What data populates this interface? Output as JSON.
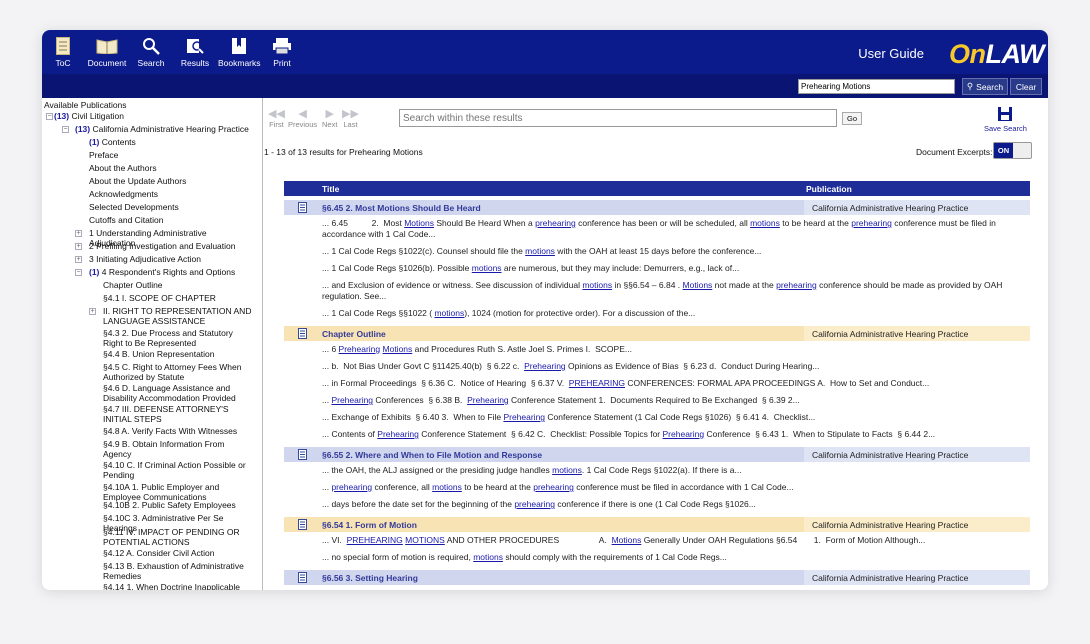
{
  "toolbar": {
    "toc": "ToC",
    "document": "Document",
    "search": "Search",
    "results": "Results",
    "bookmarks": "Bookmarks",
    "print": "Print",
    "user_guide": "User Guide",
    "logo_on": "On",
    "logo_law": "LAW"
  },
  "searchbar": {
    "value": "Prehearing Motions",
    "search_label": "Search",
    "clear_label": "Clear"
  },
  "sidebar": {
    "heading": "Available Publications",
    "items": [
      {
        "toggle": "−",
        "count": "(13)",
        "label": "Civil Litigation"
      },
      {
        "toggle": "−",
        "count": "(13)",
        "label": "California Administrative Hearing Practice"
      },
      {
        "toggle": "",
        "count": "(1)",
        "label": "Contents"
      },
      {
        "toggle": "",
        "count": "",
        "label": "Preface"
      },
      {
        "toggle": "",
        "count": "",
        "label": "About the Authors"
      },
      {
        "toggle": "",
        "count": "",
        "label": "About the Update Authors"
      },
      {
        "toggle": "",
        "count": "",
        "label": "Acknowledgments"
      },
      {
        "toggle": "",
        "count": "",
        "label": "Selected Developments"
      },
      {
        "toggle": "",
        "count": "",
        "label": "Cutoffs and Citation"
      },
      {
        "toggle": "+",
        "count": "",
        "label": "1 Understanding Administrative Adjudication"
      },
      {
        "toggle": "+",
        "count": "",
        "label": "2 Prefiling Investigation and Evaluation"
      },
      {
        "toggle": "+",
        "count": "",
        "label": "3 Initiating Adjudicative Action"
      },
      {
        "toggle": "−",
        "count": "(1)",
        "label": "4 Respondent's Rights and Options"
      },
      {
        "toggle": "",
        "count": "",
        "label": "Chapter Outline"
      },
      {
        "toggle": "",
        "count": "",
        "label": "§4.1 I. SCOPE OF CHAPTER"
      },
      {
        "toggle": "+",
        "count": "",
        "label": "II. RIGHT TO REPRESENTATION AND LANGUAGE ASSISTANCE"
      },
      {
        "toggle": "",
        "count": "",
        "label": "§4.3 2. Due Process and Statutory Right to Be Represented"
      },
      {
        "toggle": "",
        "count": "",
        "label": "§4.4 B. Union Representation"
      },
      {
        "toggle": "",
        "count": "",
        "label": "§4.5 C. Right to Attorney Fees When Authorized by Statute"
      },
      {
        "toggle": "",
        "count": "",
        "label": "§4.6 D. Language Assistance and Disability Accommodation Provided"
      },
      {
        "toggle": "",
        "count": "",
        "label": "§4.7 III. DEFENSE ATTORNEY'S INITIAL STEPS"
      },
      {
        "toggle": "",
        "count": "",
        "label": "§4.8 A. Verify Facts With Witnesses"
      },
      {
        "toggle": "",
        "count": "",
        "label": "§4.9 B. Obtain Information From Agency"
      },
      {
        "toggle": "",
        "count": "",
        "label": "§4.10 C. If Criminal Action Possible or Pending"
      },
      {
        "toggle": "",
        "count": "",
        "label": "§4.10A 1. Public Employer and Employee Communications"
      },
      {
        "toggle": "",
        "count": "",
        "label": "§4.10B 2. Public Safety Employees"
      },
      {
        "toggle": "",
        "count": "",
        "label": "§4.10C 3. Administrative Per Se Hearings"
      },
      {
        "toggle": "",
        "count": "",
        "label": "§4.11 IV. IMPACT OF PENDING OR POTENTIAL ACTIONS"
      },
      {
        "toggle": "",
        "count": "",
        "label": "§4.12 A. Consider Civil Action"
      },
      {
        "toggle": "",
        "count": "",
        "label": "§4.13 B. Exhaustion of Administrative Remedies"
      },
      {
        "toggle": "",
        "count": "",
        "label": "§4.14 1. When Doctrine Inapplicable"
      }
    ]
  },
  "nav": {
    "first": "First",
    "previous": "Previous",
    "next": "Next",
    "last": "Last",
    "go": "Go",
    "save_search": "Save Search"
  },
  "results_search": {
    "placeholder": "Search within these results"
  },
  "summary": {
    "count_text": "1 - 13 of 13 results  for Prehearing Motions",
    "excerpts_label": "Document Excerpts:",
    "toggle": "ON"
  },
  "table": {
    "col_title": "Title",
    "col_publication": "Publication",
    "rows": [
      {
        "title": "§6.45 2. Most Motions Should Be Heard",
        "publication": "California Administrative Hearing Practice",
        "color": "blue",
        "excerpts": [
          "... 6.45          2.  Most [[Motions]] Should Be Heard When a [[prehearing]] conference has been or will be scheduled, all [[motions]] to be heard at the [[prehearing]] conference must be filed in accordance with 1 Cal Code...",
          "... 1 Cal Code Regs §1022(c). Counsel should file the [[motions]] with the OAH at least 15 days before the conference...",
          "... 1 Cal Code Regs §1026(b). Possible [[motions]] are numerous, but they may include: Demurrers, e.g., lack of...",
          "... and Exclusion of evidence or witness. See discussion of individual [[motions]] in §§6.54 – 6.84 . [[Motions]] not made at the [[prehearing]] conference should be made as provided by OAH regulation. See...",
          "... 1 Cal Code Regs §§1022 ( [[motions]]), 1024 (motion for protective order). For a discussion of the..."
        ]
      },
      {
        "title": "Chapter Outline",
        "publication": "California Administrative Hearing Practice",
        "color": "tan",
        "excerpts": [
          "... 6 [[Prehearing]] [[Motions]] and Procedures Ruth S. Astle Joel S. Primes I.  SCOPE...",
          "... b.  Not Bias Under Govt C §11425.40(b)  § 6.22 c.  [[Prehearing]] Opinions as Evidence of Bias  § 6.23 d.  Conduct During Hearing...",
          "... in Formal Proceedings  § 6.36 C.  Notice of Hearing  § 6.37 V.  [[PREHEARING]] CONFERENCES: FORMAL APA PROCEEDINGS A.  How to Set and Conduct...",
          "... [[Prehearing]] Conferences  § 6.38 B.  [[Prehearing]] Conference Statement 1.  Documents Required to Be Exchanged  § 6.39 2...",
          "... Exchange of Exhibits  § 6.40 3.  When to File [[Prehearing]] Conference Statement (1 Cal Code Regs §1026)  § 6.41 4.  Checklist...",
          "... Contents of [[Prehearing]] Conference Statement  § 6.42 C.  Checklist: Possible Topics for [[Prehearing]] Conference  § 6.43 1.  When to Stipulate to Facts  § 6.44 2..."
        ]
      },
      {
        "title": "§6.55 2. Where and When to File Motion and Response",
        "publication": "California Administrative Hearing Practice",
        "color": "blue",
        "excerpts": [
          "... the OAH, the ALJ assigned or the presiding judge handles [[motions]]. 1 Cal Code Regs §1022(a). If there is a...",
          "... [[prehearing]] conference, all [[motions]] to be heard at the [[prehearing]] conference must be filed in accordance with 1 Cal Code...",
          "... days before the date set for the beginning of the [[prehearing]] conference if there is one (1 Cal Code Regs §1026..."
        ]
      },
      {
        "title": "§6.54 1. Form of Motion",
        "publication": "California Administrative Hearing Practice",
        "color": "tan",
        "excerpts": [
          "... VI.  [[PREHEARING]] [[MOTIONS]] AND OTHER PROCEDURES                 A.  [[Motions]] Generally Under OAH Regulations §6.54       1.  Form of Motion Although...",
          "... no special form of motion is required, [[motions]] should comply with the requirements of 1 Cal Code Regs..."
        ]
      },
      {
        "title": "§6.56 3. Setting Hearing",
        "publication": "California Administrative Hearing Practice",
        "color": "blue",
        "excerpts": [
          "... 6.56          3.  Setting Hearing Most [[motions]] will be heard at the [[prehearing]] conference. See 1 Cal Code Regs §1022(a). If the..."
        ]
      }
    ]
  }
}
